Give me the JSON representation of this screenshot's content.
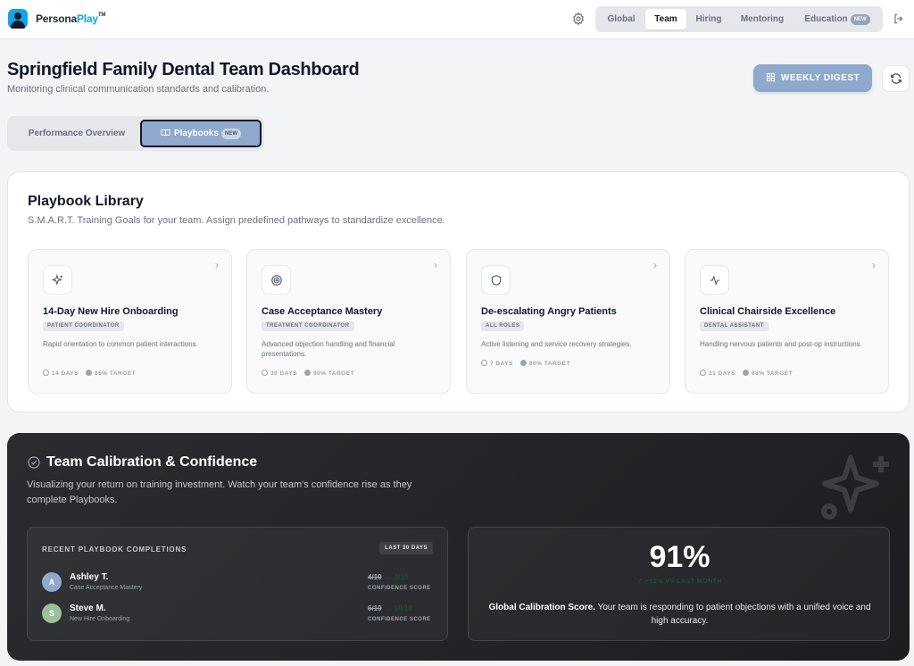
{
  "brand": {
    "name_prefix": "Persona",
    "name_accent": "Play",
    "trademark": "TM"
  },
  "nav": {
    "tabs": [
      {
        "label": "Global"
      },
      {
        "label": "Team"
      },
      {
        "label": "Hiring"
      },
      {
        "label": "Mentoring"
      },
      {
        "label": "Education",
        "badge": "NEW"
      }
    ],
    "active_tab": "Team"
  },
  "header": {
    "title": "Springfield Family Dental Team Dashboard",
    "subtitle": "Monitoring clinical communication standards and calibration.",
    "digest_label": "WEEKLY DIGEST"
  },
  "view_tabs": {
    "performance_label": "Performance Overview",
    "playbooks_label": "Playbooks",
    "playbooks_badge": "NEW"
  },
  "library": {
    "title": "Playbook Library",
    "subtitle": "S.M.A.R.T. Training Goals for your team. Assign predefined pathways to standardize excellence.",
    "cards": [
      {
        "icon": "sparkles-icon",
        "title": "14-Day New Hire Onboarding",
        "role": "PATIENT COORDINATOR",
        "description": "Rapid orientation to common patient interactions.",
        "duration": "14 DAYS",
        "target": "85% TARGET"
      },
      {
        "icon": "target-icon",
        "title": "Case Acceptance Mastery",
        "role": "TREATMENT COORDINATOR",
        "description": "Advanced objection handling and financial presentations.",
        "duration": "30 DAYS",
        "target": "90% TARGET"
      },
      {
        "icon": "shield-icon",
        "title": "De-escalating Angry Patients",
        "role": "ALL ROLES",
        "description": "Active listening and service recovery strategies.",
        "duration": "7 DAYS",
        "target": "80% TARGET"
      },
      {
        "icon": "activity-icon",
        "title": "Clinical Chairside Excellence",
        "role": "DENTAL ASSISTANT",
        "description": "Handling nervous patients and post-op instructions.",
        "duration": "21 DAYS",
        "target": "88% TARGET"
      }
    ]
  },
  "calibration": {
    "title": "Team Calibration & Confidence",
    "subtitle": "Visualizing your return on training investment. Watch your team's confidence rise as they complete Playbooks.",
    "recent": {
      "heading": "RECENT PLAYBOOK COMPLETIONS",
      "range": "LAST 30 DAYS",
      "rows": [
        {
          "initial": "A",
          "name": "Ashley T.",
          "course": "Case Acceptance Mastery",
          "old": "4/10",
          "new": "→ 9/10",
          "label": "CONFIDENCE SCORE",
          "color": "#8fa9cc"
        },
        {
          "initial": "S",
          "name": "Steve M.",
          "course": "New Hire Onboarding",
          "old": "6/10",
          "new": "→ 10/10",
          "label": "CONFIDENCE SCORE",
          "color": "#9cbf9a"
        }
      ]
    },
    "global": {
      "score": "91%",
      "delta": "↗ +12% VS LAST MONTH",
      "label": "Global Calibration Score.",
      "description": "Your team is responding to patient objections with a unified voice and high accuracy."
    }
  }
}
